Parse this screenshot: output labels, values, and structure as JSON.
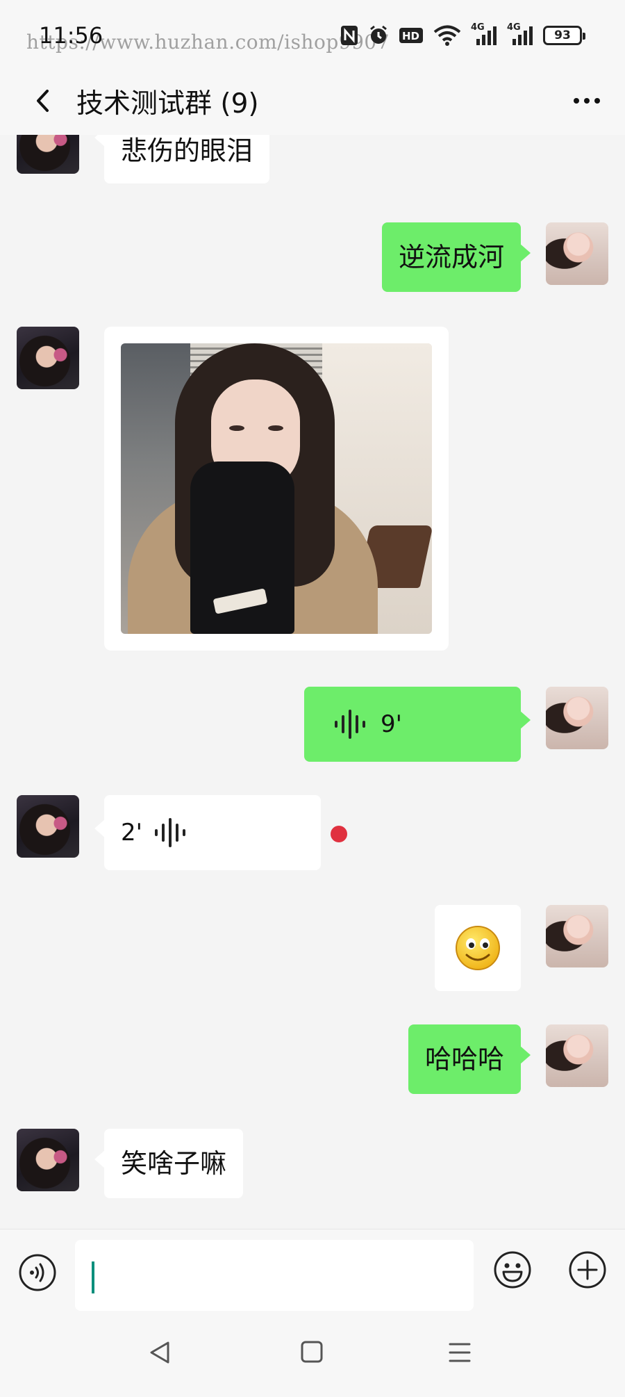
{
  "status_bar": {
    "time": "11:56",
    "watermark": "https://www.huzhan.com/ishop9907",
    "network_1": "4G",
    "network_2": "4G",
    "battery": "93"
  },
  "header": {
    "title": "技术测试群 (9)"
  },
  "messages": [
    {
      "side": "left",
      "type": "text",
      "text": "悲伤的眼泪"
    },
    {
      "side": "right",
      "type": "text",
      "text": "逆流成河"
    },
    {
      "side": "left",
      "type": "image"
    },
    {
      "side": "right",
      "type": "voice",
      "duration": "9'"
    },
    {
      "side": "left",
      "type": "voice",
      "duration": "2'",
      "unread": true
    },
    {
      "side": "right",
      "type": "sticker",
      "icon": "smiley-emoji-icon"
    },
    {
      "side": "right",
      "type": "text",
      "text": "哈哈哈"
    },
    {
      "side": "left",
      "type": "text",
      "text": "笑啥子嘛"
    }
  ],
  "input": {
    "value": "",
    "placeholder": ""
  },
  "colors": {
    "outgoing_bubble": "#6ded6a",
    "incoming_bubble": "#ffffff",
    "unread_dot": "#e0313f",
    "background": "#f4f4f4"
  }
}
